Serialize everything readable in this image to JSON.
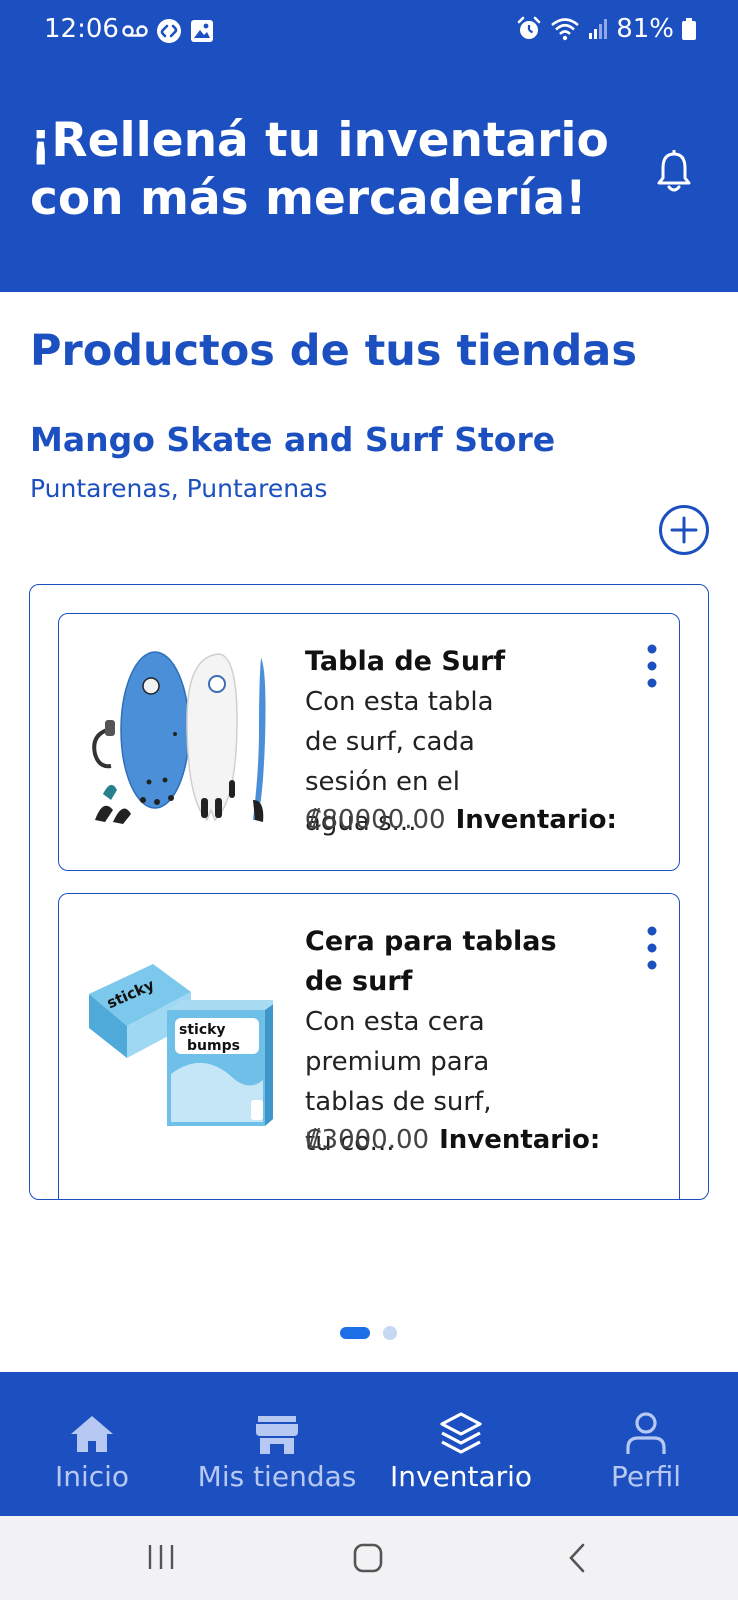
{
  "status_bar": {
    "time": "12:06",
    "battery": "81%",
    "left_icons": [
      "voicemail-icon",
      "shazam-icon",
      "gallery-icon"
    ],
    "right_icons": [
      "alarm-icon",
      "wifi-icon",
      "signal-icon",
      "battery-icon"
    ]
  },
  "header": {
    "title": "¡Rellená tu inventario con más mercadería!",
    "bell_icon": "bell-icon"
  },
  "main": {
    "section_title": "Productos de tus tiendas",
    "store": {
      "name": "Mango Skate and Surf Store",
      "location": "Puntarenas, Puntarenas",
      "add_icon": "plus-circle-icon"
    },
    "products": [
      {
        "name": "Tabla de Surf",
        "description": "Con esta tabla de surf, cada sesión en el agua s...",
        "price": "₡80000.00",
        "inventory_label": "Inventario:",
        "image_icon": "surfboard-image"
      },
      {
        "name": "Cera para tablas de surf",
        "description": "Con esta cera premium para tablas de surf, tu co...",
        "price": "₡3000.00",
        "inventory_label": "Inventario:",
        "image_icon": "surf-wax-image"
      }
    ],
    "pagination": {
      "pages": 2,
      "active_page": 1
    }
  },
  "bottom_nav": {
    "items": [
      {
        "label": "Inicio",
        "icon": "home-icon",
        "active": false
      },
      {
        "label": "Mis tiendas",
        "icon": "store-icon",
        "active": false
      },
      {
        "label": "Inventario",
        "icon": "layers-icon",
        "active": true
      },
      {
        "label": "Perfil",
        "icon": "user-icon",
        "active": false
      }
    ]
  },
  "colors": {
    "brand_blue": "#1c4fbf",
    "nav_inactive": "#b7c9f3",
    "white": "#ffffff"
  }
}
